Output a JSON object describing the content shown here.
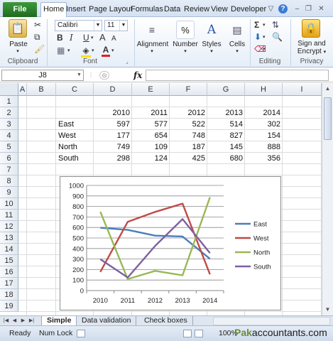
{
  "ribbon": {
    "tabs": [
      "File",
      "Home",
      "Insert",
      "Page Layout",
      "Formulas",
      "Data",
      "Review",
      "View",
      "Developer"
    ],
    "groups": {
      "clipboard": "Clipboard",
      "font": "Font",
      "editing": "Editing",
      "privacy": "Privacy"
    },
    "paste_label": "Paste",
    "font_name": "Calibri",
    "font_size": "11",
    "alignment_label": "Alignment",
    "number_label": "Number",
    "styles_label": "Styles",
    "cells_label": "Cells",
    "sign_label_1": "Sign and",
    "sign_label_2": "Encrypt",
    "bold": "B",
    "italic": "I",
    "underline": "U",
    "grow_font": "A",
    "shrink_font": "A",
    "font_color_glyph": "A",
    "percent": "%"
  },
  "formula_bar": {
    "name_box": "J8",
    "fx": "fx",
    "value": ""
  },
  "grid": {
    "columns": [
      "A",
      "B",
      "C",
      "D",
      "E",
      "F",
      "G",
      "H",
      "I"
    ],
    "rows": [
      "1",
      "2",
      "3",
      "4",
      "5",
      "6",
      "7",
      "8",
      "9",
      "10",
      "11",
      "12",
      "13",
      "14",
      "15",
      "16",
      "17",
      "18",
      "19"
    ],
    "years": [
      "2010",
      "2011",
      "2012",
      "2013",
      "2014"
    ],
    "data": [
      {
        "label": "East",
        "values": [
          "597",
          "577",
          "522",
          "514",
          "302"
        ]
      },
      {
        "label": "West",
        "values": [
          "177",
          "654",
          "748",
          "827",
          "154"
        ]
      },
      {
        "label": "North",
        "values": [
          "749",
          "109",
          "187",
          "145",
          "888"
        ]
      },
      {
        "label": "South",
        "values": [
          "298",
          "124",
          "425",
          "680",
          "356"
        ]
      }
    ]
  },
  "chart_data": {
    "type": "line",
    "categories": [
      "2010",
      "2011",
      "2012",
      "2013",
      "2014"
    ],
    "series": [
      {
        "name": "East",
        "color": "#4a7ebb",
        "values": [
          597,
          577,
          522,
          514,
          302
        ]
      },
      {
        "name": "West",
        "color": "#be4b48",
        "values": [
          177,
          654,
          748,
          827,
          154
        ]
      },
      {
        "name": "North",
        "color": "#98b954",
        "values": [
          749,
          109,
          187,
          145,
          888
        ]
      },
      {
        "name": "South",
        "color": "#7d60a0",
        "values": [
          298,
          124,
          425,
          680,
          356
        ]
      }
    ],
    "ylim": [
      0,
      1000
    ],
    "yticks": [
      0,
      100,
      200,
      300,
      400,
      500,
      600,
      700,
      800,
      900,
      1000
    ],
    "grid": true,
    "legend": "right",
    "title": "",
    "xlabel": "",
    "ylabel": ""
  },
  "sheets": {
    "tabs": [
      "Simple",
      "Data validation",
      "Check boxes"
    ],
    "active": "Simple"
  },
  "status": {
    "ready": "Ready",
    "numlock": "Num Lock",
    "zoom": "100%"
  },
  "watermark": {
    "brand": "Pak",
    "rest": "accountants.com"
  }
}
